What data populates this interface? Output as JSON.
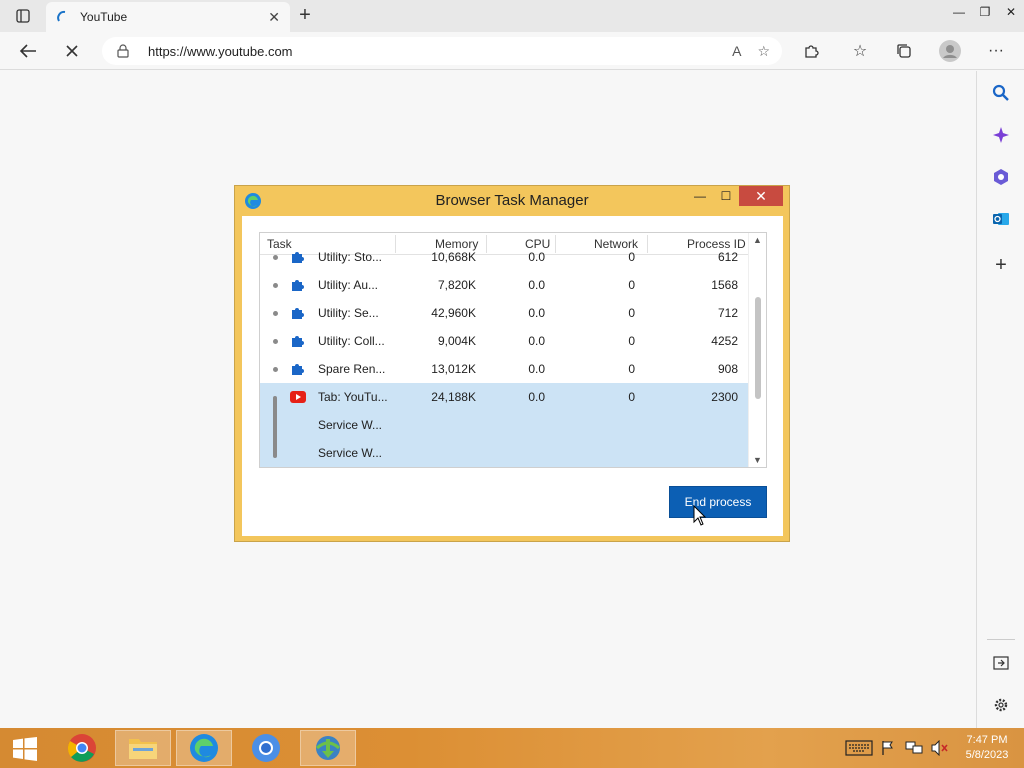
{
  "browser": {
    "tab_title": "YouTube",
    "url": "https://www.youtube.com"
  },
  "dialog": {
    "title": "Browser Task Manager",
    "columns": [
      "Task",
      "Memory",
      "CPU",
      "Network",
      "Process ID"
    ],
    "rows": [
      {
        "name": "Utility: Sto...",
        "memory": "10,668K",
        "cpu": "0.0",
        "network": "0",
        "pid": "612",
        "icon": "puzzle-icon"
      },
      {
        "name": "Utility: Au...",
        "memory": "7,820K",
        "cpu": "0.0",
        "network": "0",
        "pid": "1568",
        "icon": "puzzle-icon"
      },
      {
        "name": "Utility: Se...",
        "memory": "42,960K",
        "cpu": "0.0",
        "network": "0",
        "pid": "712",
        "icon": "puzzle-icon"
      },
      {
        "name": "Utility: Coll...",
        "memory": "9,004K",
        "cpu": "0.0",
        "network": "0",
        "pid": "4252",
        "icon": "puzzle-icon"
      },
      {
        "name": "Spare Ren...",
        "memory": "13,012K",
        "cpu": "0.0",
        "network": "0",
        "pid": "908",
        "icon": "puzzle-icon"
      },
      {
        "name": "Tab: YouTu...",
        "memory": "24,188K",
        "cpu": "0.0",
        "network": "0",
        "pid": "2300",
        "icon": "youtube-icon"
      },
      {
        "name": "Service W...",
        "memory": "",
        "cpu": "",
        "network": "",
        "pid": "",
        "icon": ""
      },
      {
        "name": "Service W...",
        "memory": "",
        "cpu": "",
        "network": "",
        "pid": "",
        "icon": ""
      }
    ],
    "end_button": "End process"
  },
  "taskbar": {
    "time": "7:47 PM",
    "date": "5/8/2023"
  },
  "colors": {
    "dialog_frame": "#f3c65c",
    "close_red": "#c84b40",
    "selection": "#cce3f5",
    "primary_button": "#0c5fb4",
    "taskbar": "#d58a32"
  }
}
